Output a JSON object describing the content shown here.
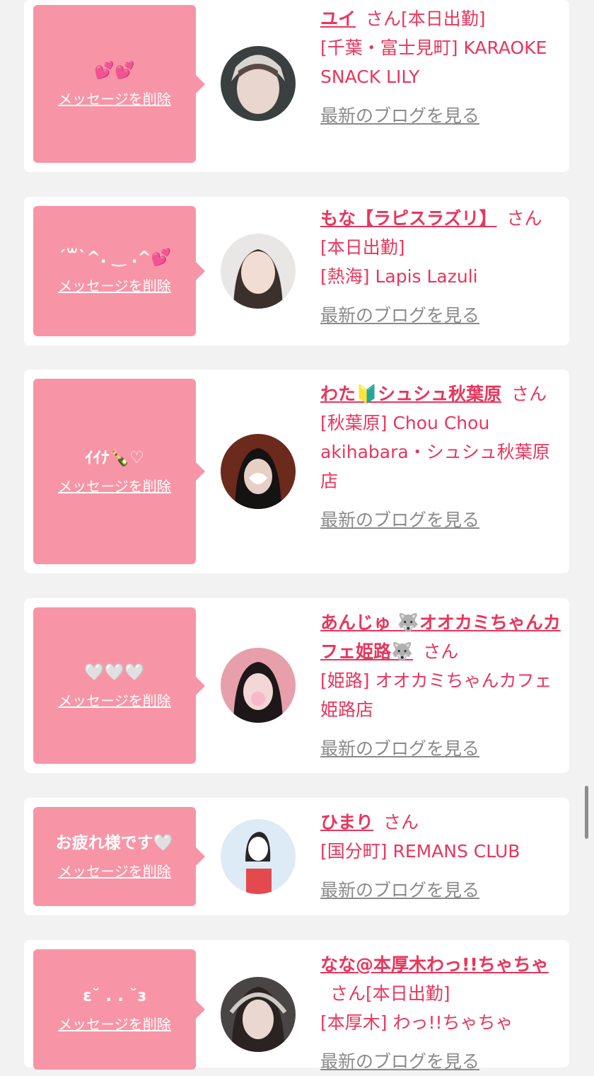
{
  "delete_label": "メッセージを削除",
  "blog_label": "最新のブログを見る",
  "cards": [
    {
      "message": "💕💕",
      "name": "ユイ",
      "suffix": "さん[本日出勤]",
      "shop": "[千葉・富士見町] KARAOKE SNACK LILY"
    },
    {
      "message": "ˊ꒳ˋ^. ‿ .^💕",
      "name": "もな【ラピスラズリ】",
      "suffix": "さん[本日出勤]",
      "shop": "[熱海] Lapis Lazuli"
    },
    {
      "message": "ｲｲﾅ🍾♡",
      "name": "わた🔰シュシュ秋葉原",
      "suffix": "さん",
      "shop": "[秋葉原] Chou Chou akihabara・シュシュ秋葉原店"
    },
    {
      "message": "🤍🤍🤍",
      "name": "あんじゅ 🐺オオカミちゃんカフェ姫路🐺",
      "suffix": "さん",
      "shop": "[姫路] オオカミちゃんカフェ姫路店"
    },
    {
      "message": "お疲れ様です🤍",
      "name": "ひまり",
      "suffix": "さん",
      "shop": "[国分町] REMANS CLUB"
    },
    {
      "message": "ɛ˘ . . ˘ɜ",
      "name": "なな@本厚木わっ!!ちゃちゃ",
      "suffix": "さん[本日出勤]",
      "shop": "[本厚木] わっ!!ちゃちゃ"
    }
  ],
  "colors": {
    "accent": "#e8365c",
    "bubble": "#f795a6",
    "link_gray": "#8a8a8a",
    "background": "#f2f2f2"
  }
}
